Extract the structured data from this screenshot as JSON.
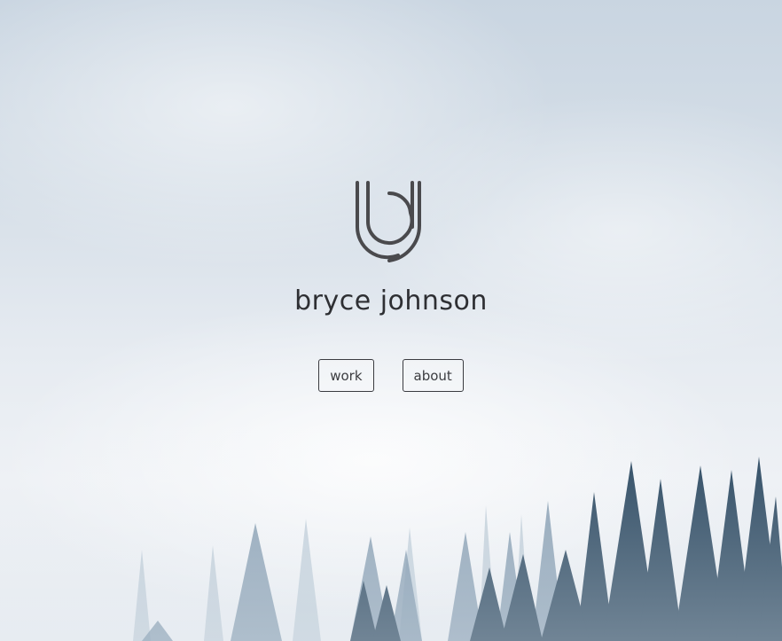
{
  "brand": {
    "logo_icon": "bj-monogram-icon",
    "name": "bryce johnson"
  },
  "nav": {
    "work_label": "work",
    "about_label": "about"
  },
  "background": {
    "scene": "misty-forest-sky-image",
    "colors": {
      "sky": "#c9d5e1",
      "fog": "#eef1f5",
      "trees": "#2e4a63"
    }
  }
}
